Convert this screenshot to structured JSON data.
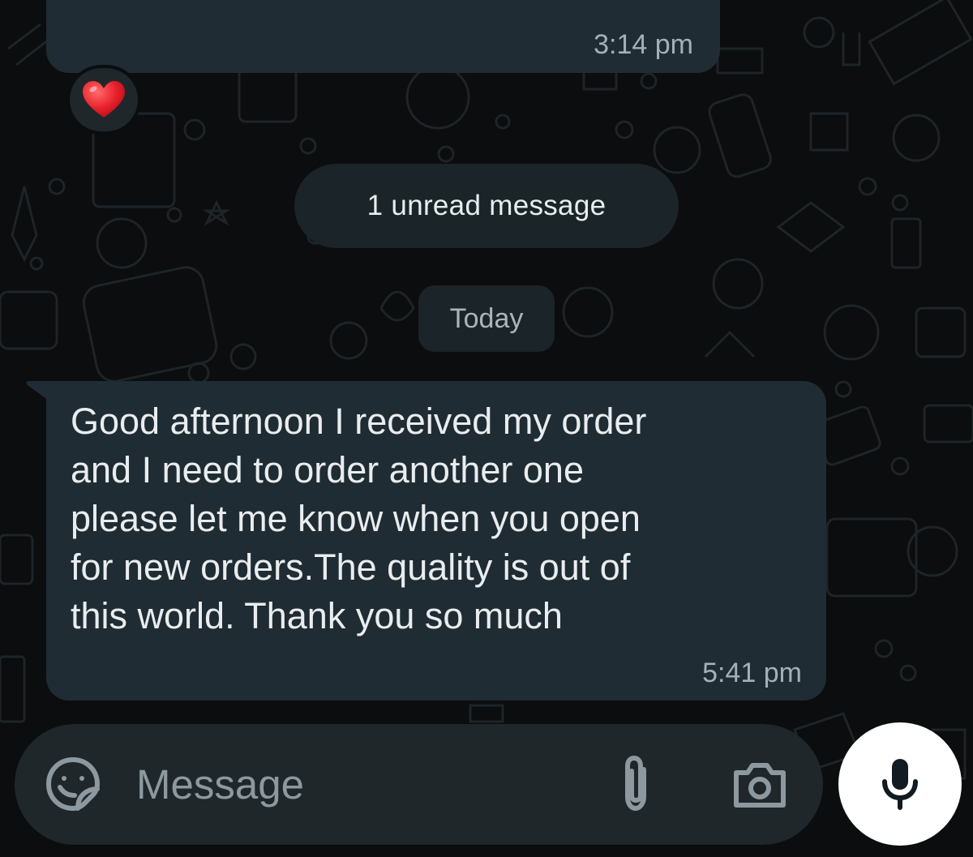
{
  "chat": {
    "previous_message": {
      "time": "3:14 pm",
      "reaction": "❤️"
    },
    "unread_divider": "1 unread message",
    "date_divider": "Today",
    "incoming_message": {
      "text": "Good afternoon I received my order\nand I need to order another one\nplease let me know when you open\nfor new orders.The quality is out of\nthis world. Thank you so much",
      "time": "5:41 pm"
    }
  },
  "composer": {
    "placeholder": "Message",
    "icons": {
      "emoji": "sticker-emoji-icon",
      "attach": "paperclip-icon",
      "camera": "camera-icon",
      "send": "microphone-icon"
    }
  },
  "colors": {
    "background": "#0b0d0e",
    "incoming_bubble": "#202c33",
    "composer": "#1f272b",
    "mic_button": "#ffffff",
    "text_primary": "#e9edef",
    "text_secondary": "#a5b0b6"
  }
}
